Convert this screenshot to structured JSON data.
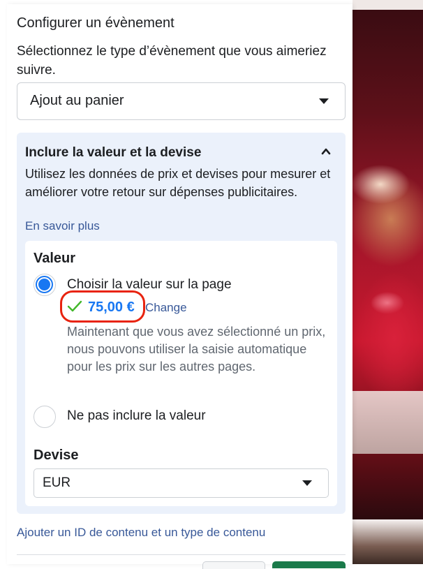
{
  "dialog": {
    "title": "Configurer un évènement",
    "description": "Sélectionnez le type d’évènement que vous aimeriez suivre.",
    "event_select": {
      "value": "Ajout au panier",
      "icon": "caret-down-icon"
    }
  },
  "value_section": {
    "title": "Inclure la valeur et la devise",
    "collapse_icon": "chevron-up-icon",
    "description": "Utilisez les données de prix et devises pour mesurer et améliorer votre retour sur dépenses publicitaires.",
    "learn_more": "En savoir plus",
    "value_heading": "Valeur",
    "options": [
      {
        "label": "Choisir la valeur sur la page",
        "selected": true
      },
      {
        "label": "Ne pas inclure la valeur",
        "selected": false
      }
    ],
    "selected_price": "75,00 €",
    "check_icon": "check-icon",
    "change_label": "Change",
    "helper_text": "Maintenant que vous avez sélectionné un prix, nous pouvons utiliser la saisie automatique pour les prix sur les autres pages.",
    "currency_heading": "Devise",
    "currency_select": {
      "value": "EUR",
      "icon": "caret-down-icon"
    }
  },
  "footer": {
    "add_content_link": "Ajouter un ID de contenu et un type de contenu"
  },
  "colors": {
    "accent": "#1877f2",
    "link": "#385898",
    "highlight_circle": "#e8230f",
    "check": "#42b72a",
    "section_bg": "#ebf1fb"
  }
}
